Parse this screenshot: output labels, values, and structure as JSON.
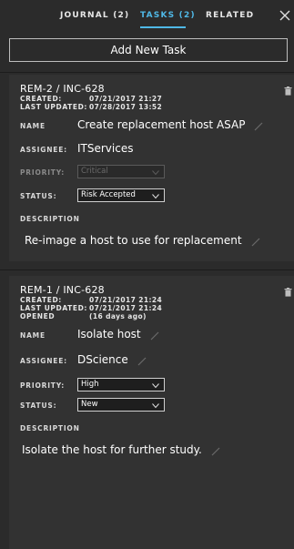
{
  "tabs": [
    {
      "label": "JOURNAL (2)"
    },
    {
      "label": "TASKS (2)"
    },
    {
      "label": "RELATED"
    }
  ],
  "add_button_label": "Add New Task",
  "labels": {
    "created": "CREATED:",
    "last_updated": "LAST UPDATED:",
    "opened": "OPENED",
    "name": "NAME",
    "assignee": "ASSIGNEE:",
    "priority": "PRIORITY:",
    "status": "STATUS:",
    "description": "DESCRIPTION"
  },
  "tasks": [
    {
      "ref": "REM-2 / INC-628",
      "created": "07/21/2017 21:27",
      "last_updated": "07/28/2017 13:52",
      "name": "Create replacement host ASAP",
      "assignee": "ITServices",
      "priority": "Critical",
      "priority_disabled": true,
      "status": "Risk Accepted",
      "description": "Re-image a host to use for replacement"
    },
    {
      "ref": "REM-1 / INC-628",
      "created": "07/21/2017 21:24",
      "last_updated": "07/21/2017 21:24",
      "opened": "(16 days ago)",
      "name": "Isolate host",
      "assignee": "DScience",
      "priority": "High",
      "priority_disabled": false,
      "status": "New",
      "description": "Isolate the host for further study."
    }
  ],
  "colors": {
    "background": "#2b2b2b",
    "card": "#323232",
    "accent": "#4fb8e6"
  },
  "icons": [
    "close-icon",
    "trash-icon",
    "pencil-icon",
    "chevron-down-icon"
  ]
}
